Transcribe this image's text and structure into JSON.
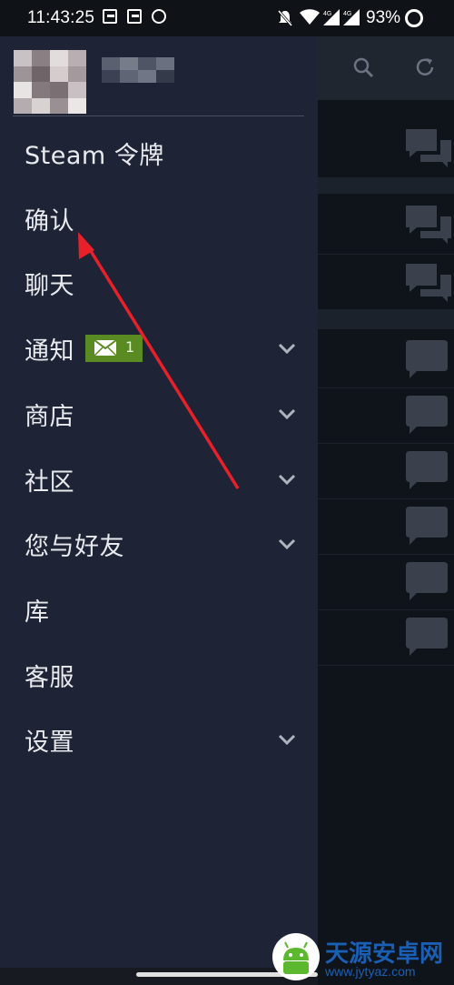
{
  "status_bar": {
    "time": "11:43:25",
    "icons": [
      "notification-box-icon",
      "notification-box-icon",
      "sync-ring-icon",
      "mute-bell-icon",
      "wifi-icon",
      "signal-4g-icon",
      "signal-4g-icon"
    ],
    "net_label_1": "4G",
    "net_label_2": "4G",
    "battery": "93%"
  },
  "drawer": {
    "menu": [
      {
        "label": "Steam 令牌",
        "expandable": false
      },
      {
        "label": "确认",
        "expandable": false
      },
      {
        "label": "聊天",
        "expandable": false
      },
      {
        "label": "通知",
        "expandable": true,
        "badge": {
          "icon": "envelope-icon",
          "count": "1"
        }
      },
      {
        "label": "商店",
        "expandable": true
      },
      {
        "label": "社区",
        "expandable": true
      },
      {
        "label": "您与好友",
        "expandable": true
      },
      {
        "label": "库",
        "expandable": false
      },
      {
        "label": "客服",
        "expandable": false
      },
      {
        "label": "设置",
        "expandable": true
      }
    ]
  },
  "background_app": {
    "header_icons": [
      "search-icon",
      "refresh-icon"
    ]
  },
  "watermark": {
    "title": "天源安卓网",
    "url": "www.jytyaz.com"
  },
  "colors": {
    "drawer_bg": "#1e2436",
    "badge_green": "#5a8a22",
    "annotation_red": "#e8202a"
  }
}
